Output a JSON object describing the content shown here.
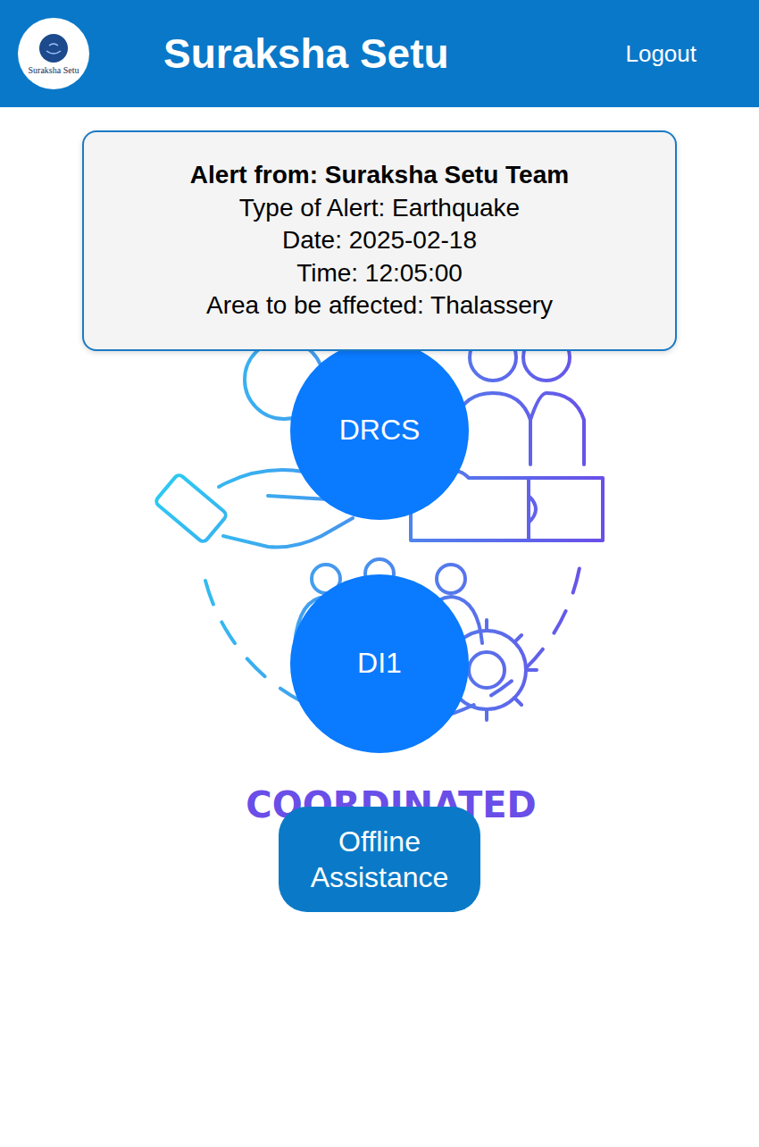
{
  "header": {
    "logo_text": "Suraksha Setu",
    "title": "Suraksha Setu",
    "logout": "Logout"
  },
  "alert": {
    "heading": "Alert from: Suraksha Setu Team",
    "lines": [
      "Type of Alert: Earthquake",
      "Date: 2025-02-18",
      "Time: 12:05:00",
      "Area to be affected: Thalassery"
    ]
  },
  "illustration": {
    "caption": "COORDINATED"
  },
  "buttons": [
    "DRCS",
    "DI1"
  ],
  "offline_button": "Offline Assistance"
}
